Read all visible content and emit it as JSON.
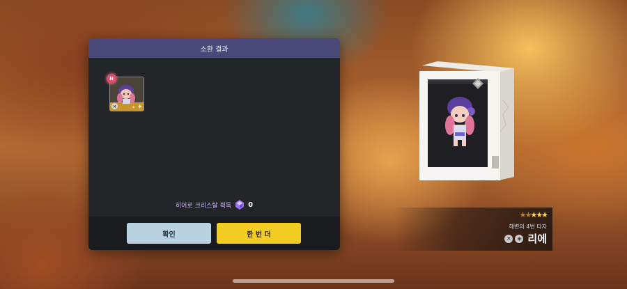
{
  "panel": {
    "title": "소환 결과",
    "result_slot": {
      "new_badge": "N",
      "cancel_mark": "×"
    },
    "crystal_label": "히어로 크리스탈 획득",
    "crystal_count": "0",
    "buttons": {
      "confirm": "확인",
      "again": "한 번 더"
    }
  },
  "character": {
    "stars_total": 5,
    "stars_lit": 3,
    "title": "해변의 4번 타자",
    "name": "리에",
    "icons": [
      "x-class-icon",
      "diamond-class-icon"
    ]
  },
  "colors": {
    "header": "#4a4878",
    "confirm_button": "#b9d2e2",
    "again_button": "#f4cd23",
    "star_lit": "#ffd63a"
  }
}
